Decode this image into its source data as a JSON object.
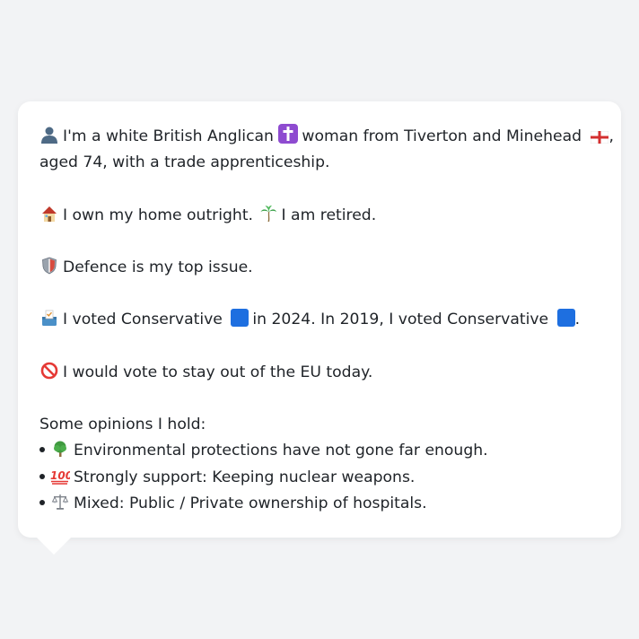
{
  "profile": {
    "line1_a": "I'm a white British Anglican",
    "line1_b": "woman from Tiverton and Minehead",
    "line1_c": ",",
    "line1_d": "aged 74, with a trade apprenticeship.",
    "home_a": "I own my home outright.",
    "home_b": "I am retired.",
    "issue": "Defence is my top issue.",
    "vote_a": "I voted Conservative",
    "vote_b": "in 2024. In 2019, I voted Conservative",
    "vote_c": ".",
    "eu": "I would vote to stay out of the EU today.",
    "opinions_header": "Some opinions I hold:",
    "opinions": [
      "Environmental protections have not gone far enough.",
      "Strongly support: Keeping nuclear weapons.",
      "Mixed: Public / Private ownership of hospitals."
    ]
  },
  "icons": {
    "person": "person-silhouette-icon",
    "cross": "latin-cross-icon",
    "flag": "england-flag-icon",
    "house": "house-icon",
    "palm": "palm-tree-icon",
    "shield": "shield-icon",
    "ballot": "ballot-box-icon",
    "party_square": "blue-square-icon",
    "no_entry": "prohibited-icon",
    "tree": "deciduous-tree-icon",
    "hundred": "hundred-points-icon",
    "scales": "balance-scale-icon"
  },
  "colors": {
    "background": "#f2f3f5",
    "bubble": "#ffffff",
    "text": "#1f2328",
    "conservative_blue": "#1e6fe0",
    "cross_purple": "#8e4bd0",
    "no_red": "#e53935"
  }
}
